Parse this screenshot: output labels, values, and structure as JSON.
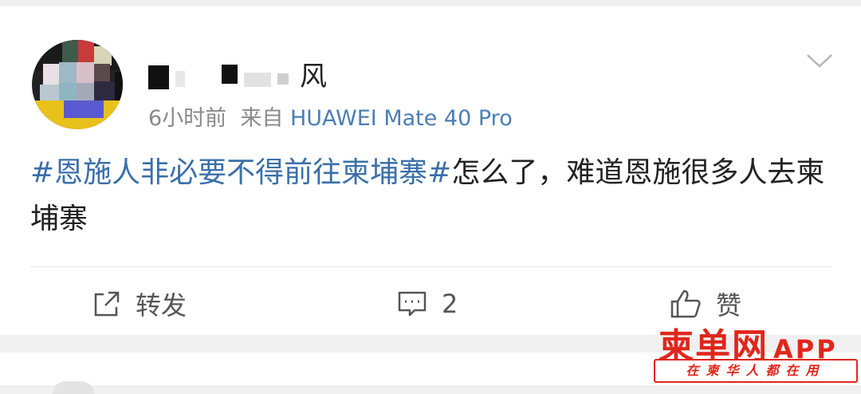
{
  "post": {
    "author_name": "风",
    "time": "6小时前",
    "source_prefix": "来自",
    "source_device": "HUAWEI Mate 40 Pro",
    "hashtag": "#恩施人非必要不得前往柬埔寨#",
    "body": "怎么了，难道恩施很多人去柬埔寨"
  },
  "actions": {
    "repost_label": "转发",
    "comment_count": "2",
    "like_label": "赞"
  },
  "watermark": {
    "brand": "柬单网",
    "app": "APP",
    "slogan": "在柬华人都在用"
  },
  "colors": {
    "hashtag": "#3b6fa8",
    "source": "#4a7fb3",
    "watermark": "#e0261c"
  },
  "icons": [
    "chevron-down-icon",
    "repost-icon",
    "comment-icon",
    "thumbs-up-icon"
  ]
}
